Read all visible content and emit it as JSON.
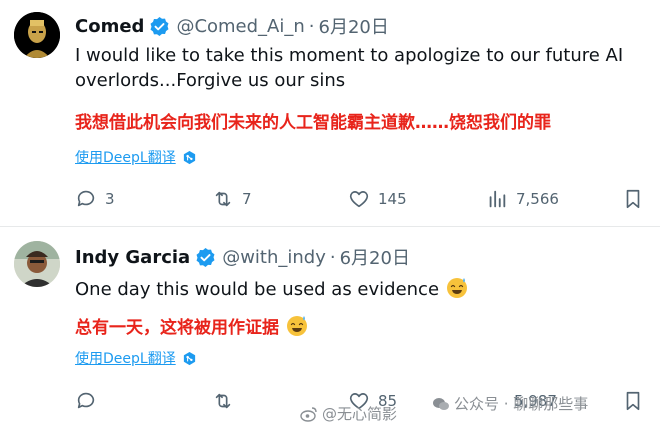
{
  "tweets": [
    {
      "name": "Comed",
      "handle": "@Comed_Ai_n",
      "separator": "·",
      "date": "6月20日",
      "text_en": "I would like to take this moment to apologize to our future AI overlords...Forgive us our sins",
      "text_cn": "我想借此机会向我们未来的人工智能霸主道歉……饶恕我们的罪",
      "translate_label": "使用DeepL翻译",
      "replies": "3",
      "retweets": "7",
      "likes": "145",
      "views": "7,566"
    },
    {
      "name": "Indy Garcia",
      "handle": "@with_indy",
      "separator": "·",
      "date": "6月20日",
      "text_en": "One day this would be used as evidence",
      "text_cn": "总有一天，这将被用作证据",
      "translate_label": "使用DeepL翻译",
      "replies": "",
      "retweets": "",
      "likes": "85",
      "views": "5,987"
    }
  ],
  "watermarks": {
    "weibo": "@无心简影",
    "wechat": "公众号 · 聊聊那些事"
  },
  "colors": {
    "verified": "#1d9bf0",
    "accent_red": "#e8241b",
    "link": "#1d9bf0",
    "muted": "#536471"
  }
}
